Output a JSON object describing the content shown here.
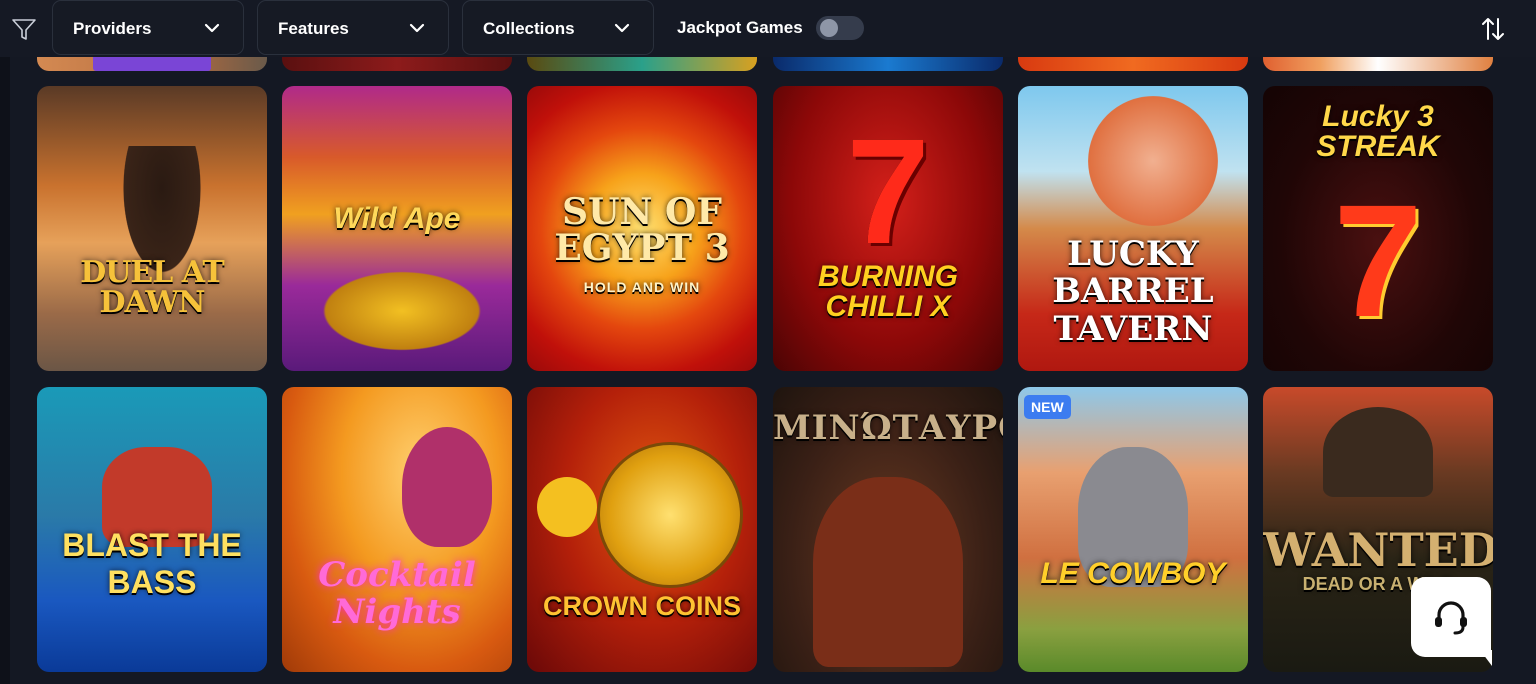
{
  "filters": {
    "providers_label": "Providers",
    "features_label": "Features",
    "collections_label": "Collections",
    "jackpot_label": "Jackpot Games",
    "jackpot_enabled": false
  },
  "games_row1": [
    {
      "title": "DUEL AT DAWN"
    },
    {
      "title": "Wild Ape"
    },
    {
      "title": "SUN OF EGYPT 3",
      "subtitle": "HOLD AND WIN"
    },
    {
      "title": "BURNING CHILLI X"
    },
    {
      "title": "LUCKY BARREL TAVERN"
    },
    {
      "title": "Lucky 3 STREAK"
    }
  ],
  "games_row2": [
    {
      "title": "BLAST THE BASS"
    },
    {
      "title": "Cocktail Nights"
    },
    {
      "title": "CROWN COINS"
    },
    {
      "title": "ΜΙΝΏΤΑΥΡΟΣ"
    },
    {
      "title": "LE COWBOY",
      "badge": "NEW"
    },
    {
      "title": "WANTED",
      "subtitle": "DEAD OR A WILD"
    }
  ],
  "colors": {
    "page_bg": "#141823",
    "accent_badge": "#3c7cf0"
  }
}
